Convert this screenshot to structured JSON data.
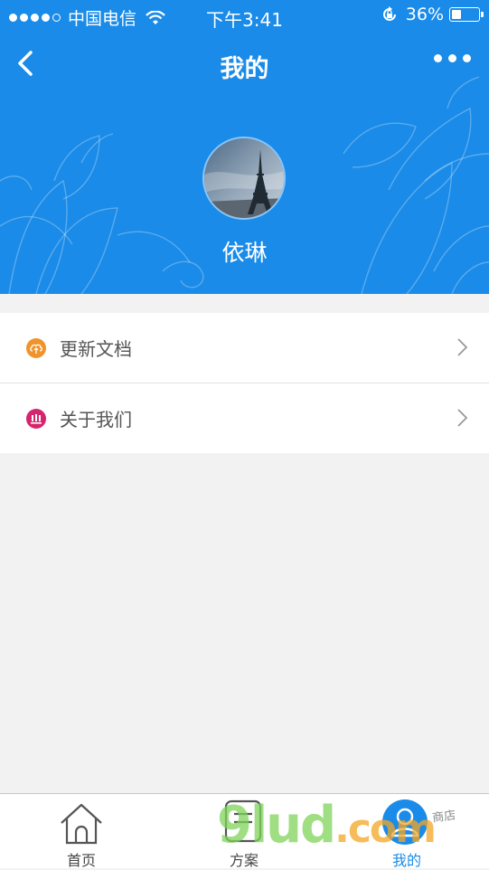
{
  "status_bar": {
    "carrier": "中国电信",
    "time": "下午3:41",
    "battery_text": "36%",
    "battery_level": 0.36
  },
  "nav": {
    "title": "我的",
    "back_icon": "chevron-left-icon",
    "more_icon": "more-dots-icon"
  },
  "profile": {
    "name": "依琳",
    "avatar": "eiffel-tower-photo"
  },
  "menu": {
    "items": [
      {
        "label": "更新文档",
        "icon": "cloud-upload-icon",
        "color": "#f0932b"
      },
      {
        "label": "关于我们",
        "icon": "team-icon",
        "color": "#d6246e"
      }
    ]
  },
  "tabbar": {
    "tabs": [
      {
        "label": "首页",
        "icon": "home-icon",
        "active": false
      },
      {
        "label": "方案",
        "icon": "document-icon",
        "active": false
      },
      {
        "label": "我的",
        "icon": "user-icon",
        "active": true
      }
    ]
  },
  "watermark": {
    "text": "9lud",
    "suffix": ".com",
    "side_text": "商店"
  },
  "colors": {
    "primary": "#1a8be8",
    "background": "#f2f2f2"
  }
}
